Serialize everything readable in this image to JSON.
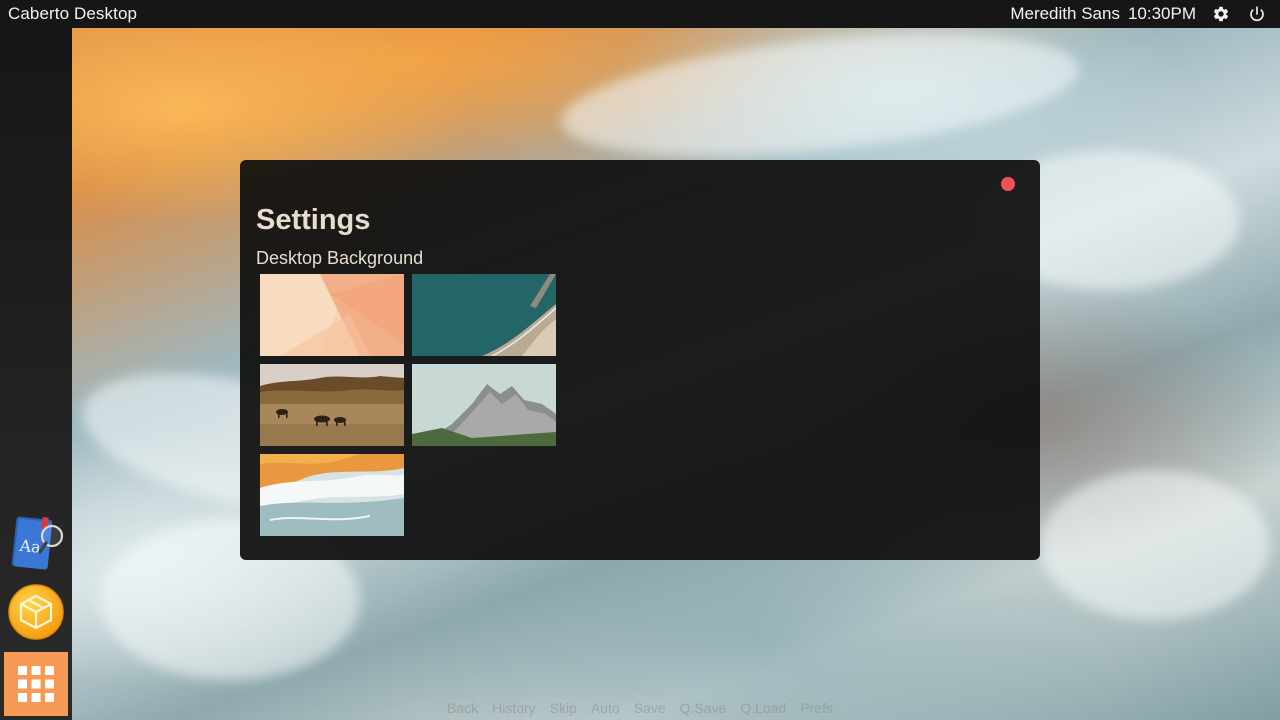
{
  "topbar": {
    "title": "Caberto Desktop",
    "user": "Meredith Sans",
    "time": "10:30PM",
    "settings_icon": "gear-icon",
    "power_icon": "power-icon"
  },
  "dock": {
    "items": [
      {
        "name": "dictionary",
        "icon": "dictionary-icon"
      },
      {
        "name": "package-manager",
        "icon": "package-icon"
      },
      {
        "name": "app-grid",
        "icon": "app-grid-icon"
      }
    ],
    "dictionary_icon_text": "Aa"
  },
  "window": {
    "title": "Settings",
    "section": "Desktop Background",
    "close_color": "#f0525a",
    "backgrounds": [
      {
        "name": "orange-abstract"
      },
      {
        "name": "coastal-aerial"
      },
      {
        "name": "horses-field"
      },
      {
        "name": "mountain-cliffs"
      },
      {
        "name": "ocean-waves"
      }
    ]
  },
  "bottom_bar": {
    "items": [
      "Back",
      "History",
      "Skip",
      "Auto",
      "Save",
      "Q.Save",
      "Q.Load",
      "Prefs"
    ]
  },
  "colors": {
    "topbar": "#161616",
    "dock_apps": "#f79a55",
    "title_text": "#e6ddd0"
  }
}
